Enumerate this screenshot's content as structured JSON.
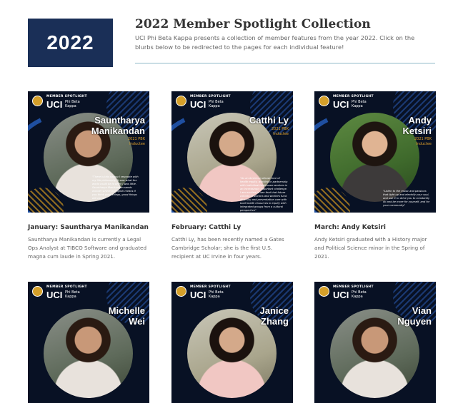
{
  "hero": {
    "badge": "2022",
    "title": "2022 Member Spotlight Collection",
    "description": "UCI Phi Beta Kappa presents a collection of member features from the year 2022. Click on the blurbs below to be redirected to the pages for each individual feature!"
  },
  "graphic": {
    "label": "MEMBER SPOTLIGHT",
    "org": "UCI",
    "chapter": "Phi Beta Kappa"
  },
  "cards": [
    {
      "name": "Sauntharya\nManikandan",
      "inductee": "2021 PBK\nInductee",
      "quote": "\"There is this saying I resonate with my life philosophy. It was what the world could be is when I was little. Sauntharya Manikandan sandu wonder where in English means it you think good things, good things will come\"",
      "title": "January: Sauntharya Manikandan",
      "description": "Sauntharya Manikandan is currently a Legal Ops Analyst at TIBCO Software and graduated magna cum laude in Spring 2021."
    },
    {
      "name": "Catthi Ly",
      "inductee": "2021 PBK\nInductee",
      "quote": "\"As an American whose love of health equity, working in partnership with individual healthcare workers is an increasingly important challenge. I am excited to see that that future cohorts of doctors and workers fund diversity and preventative care with bold health resources in equity with integrated groups from a cultural perspective\"",
      "title": "February: Catthi Ly",
      "description": "Catthi Ly, has been recently named a Gates Cambridge Scholar; she is the first U.S. recipient at UC Irvine in four years."
    },
    {
      "name": "Andy\nKetsiri",
      "inductee": "2021 PBK\nInductee",
      "quote": "\"Listen to the music and passions that light up and electrify your soul, and use it to drive you to constantly do and be more for yourself, and for your community\"",
      "title": "March: Andy Ketsiri",
      "description": "Andy Ketsiri graduated with a History major and Political Science minor in the Spring of 2021."
    },
    {
      "name": "Michelle\nWei"
    },
    {
      "name": "Janice\nZhang"
    },
    {
      "name": "Vian\nNguyen"
    }
  ]
}
